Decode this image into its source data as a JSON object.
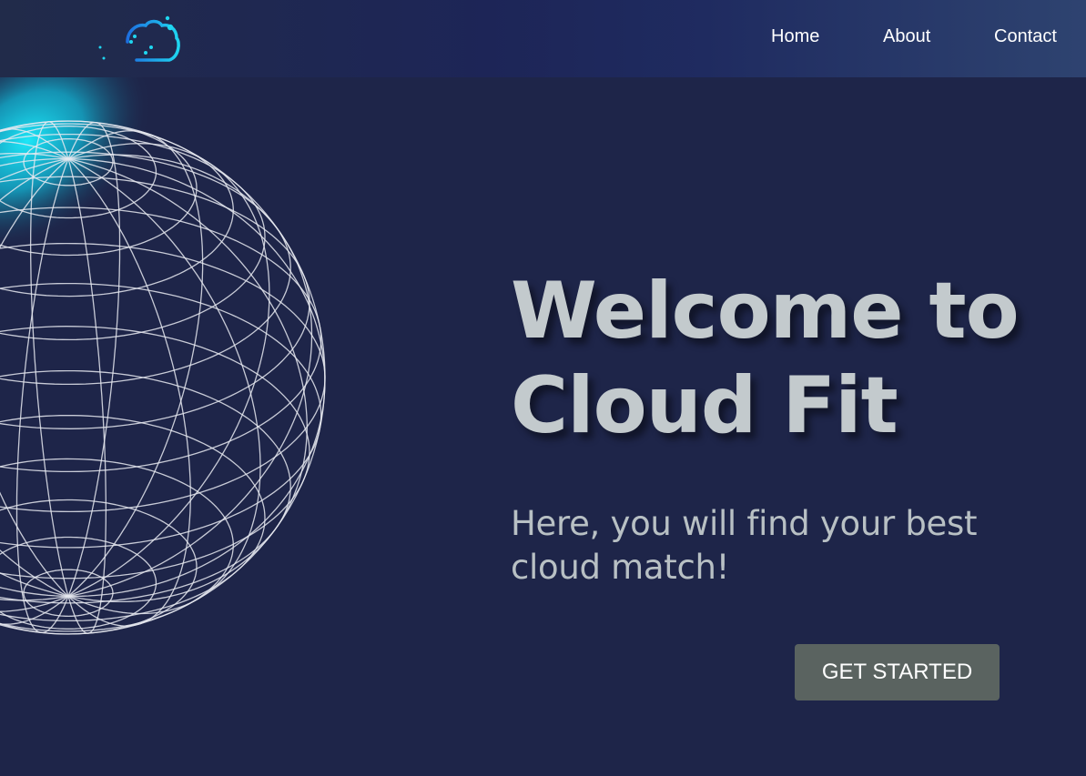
{
  "nav": {
    "logo_icon": "cloud-data-icon",
    "links": [
      {
        "label": "Home"
      },
      {
        "label": "About"
      },
      {
        "label": "Contact"
      }
    ]
  },
  "hero": {
    "title": "Welcome to Cloud Fit",
    "subtitle": "Here, you will find your best cloud match!",
    "cta_label": "GET STARTED",
    "graphic": "wireframe-globe-icon"
  },
  "colors": {
    "background": "#1e2549",
    "navbar_gradient": [
      "#212b4a",
      "#1d2557",
      "#2e4370"
    ],
    "title": "#c3cacd",
    "subtitle": "#b8c0c4",
    "button": "#5a6360",
    "accent_cyan": "#19d9f2",
    "logo_blue": "#1d7fe0"
  }
}
